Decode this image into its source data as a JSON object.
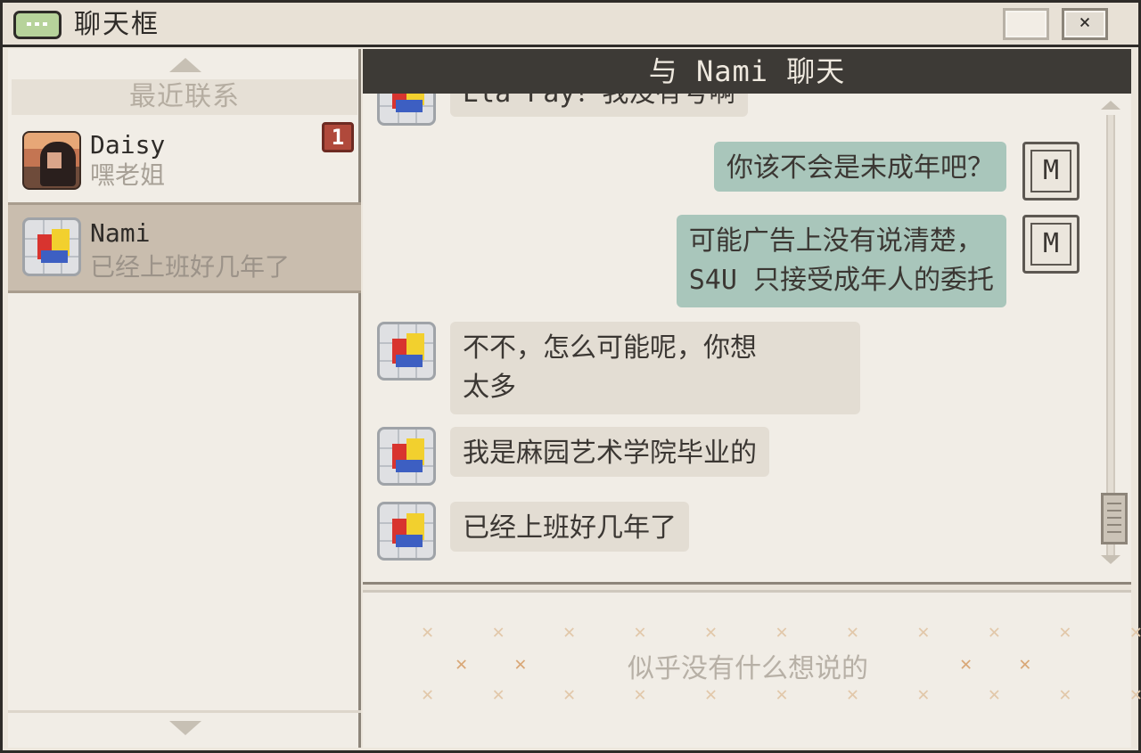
{
  "window": {
    "title": "聊天框",
    "close_label": "×"
  },
  "sidebar": {
    "header": "最近联系",
    "contacts": [
      {
        "name": "Daisy",
        "last_message": "嘿老姐",
        "unread": "1"
      },
      {
        "name": "Nami",
        "last_message": "已经上班好几年了"
      }
    ]
  },
  "chat": {
    "header": "与 Nami 聊天",
    "messages": [
      {
        "from": "Nami",
        "text": "Ela Pay？我没有号啊"
      },
      {
        "from": "me",
        "text": "你该不会是未成年吧？"
      },
      {
        "from": "me",
        "text": "可能广告上没有说清楚，\nS4U 只接受成年人的委托"
      },
      {
        "from": "Nami",
        "text": "不不，怎么可能呢，你想\n太多"
      },
      {
        "from": "Nami",
        "text": "我是麻园艺术学院毕业的"
      },
      {
        "from": "Nami",
        "text": "已经上班好几年了"
      }
    ],
    "my_avatar_letter": "M"
  },
  "input": {
    "placeholder": "似乎没有什么想说的"
  },
  "colors": {
    "incoming_bubble": "#e3ddd3",
    "outgoing_bubble": "#a9c6bb",
    "header_bg": "#3d3a36",
    "badge": "#b0493b",
    "selected_contact": "#c9bdae"
  }
}
